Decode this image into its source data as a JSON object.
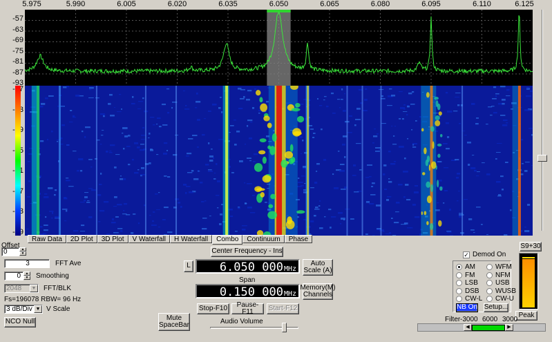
{
  "frequency_axis": [
    "5.975",
    "5.990",
    "6.005",
    "6.020",
    "6.035",
    "6.050",
    "6.065",
    "6.080",
    "6.095",
    "6.110",
    "6.125"
  ],
  "spectrum_db_labels": [
    "-57",
    "-63",
    "-69",
    "-75",
    "-81",
    "-87",
    "-93"
  ],
  "waterfall_db_labels": [
    "-57",
    "-63",
    "-69",
    "-75",
    "-81",
    "-87",
    "-93",
    "-99"
  ],
  "spectrum_peaks_mhz": [
    5.9795,
    6.0345,
    6.05,
    6.0585,
    6.095,
    6.121
  ],
  "tabs": [
    "Raw Data",
    "2D Plot",
    "3D Plot",
    "V Waterfall",
    "H Waterfall",
    "Combo",
    "Continuum",
    "Phase"
  ],
  "active_tab": "Combo",
  "left_panel": {
    "offset_label": "Offset",
    "offset_value": "0",
    "fft_ave_value": "3",
    "fft_ave_label": "FFT Ave",
    "smoothing_value": "0",
    "smoothing_label": "Smoothing",
    "fft_blk_value": "2048",
    "fft_blk_label": "FFT/BLK",
    "fs_rbw_text": "Fs=196078 RBW=  96 Hz",
    "vscale_value": "3 dB/Div",
    "vscale_label": "V Scale",
    "nco_null_label": "NCO Null"
  },
  "center_panel": {
    "center_freq_button": "Center Frequency - Ins",
    "l_button": "L",
    "center_freq_value": "6.050 000",
    "center_freq_unit": "MHz",
    "auto_scale_button": "Auto Scale (A)",
    "span_label": "Span",
    "span_value": "0.150 000",
    "span_unit": "MHz",
    "memory_button": "Memory(M) Channels",
    "stop_button": "Stop-F10",
    "pause_button": "Pause-F11",
    "start_button": "Start-F12",
    "mute_button": "Mute SpaceBar",
    "audio_volume_label": "Audio Volume",
    "audio_volume_level": 0.86
  },
  "demod_panel": {
    "demod_on_label": "Demod On",
    "demod_on_checked": true,
    "modes": [
      "AM",
      "WFM",
      "FM",
      "NFM",
      "LSB",
      "USB",
      "DSB",
      "WUSB",
      "CW-L",
      "CW-U"
    ],
    "selected_mode": "AM",
    "nb_button": "NB On",
    "setup_button": "Setup...",
    "s_meter_label": "S9+30",
    "s_meter_level": 0.92,
    "peak_button": "Peak",
    "filter_label": "Filter",
    "filter_low": "-3000",
    "filter_width": "6000",
    "filter_high": "3000"
  },
  "colors": {
    "trace": "#3ce83c",
    "highlight": "#808080",
    "waterfall_bg": "#0a1a9a",
    "marker": "#2fd42f"
  }
}
